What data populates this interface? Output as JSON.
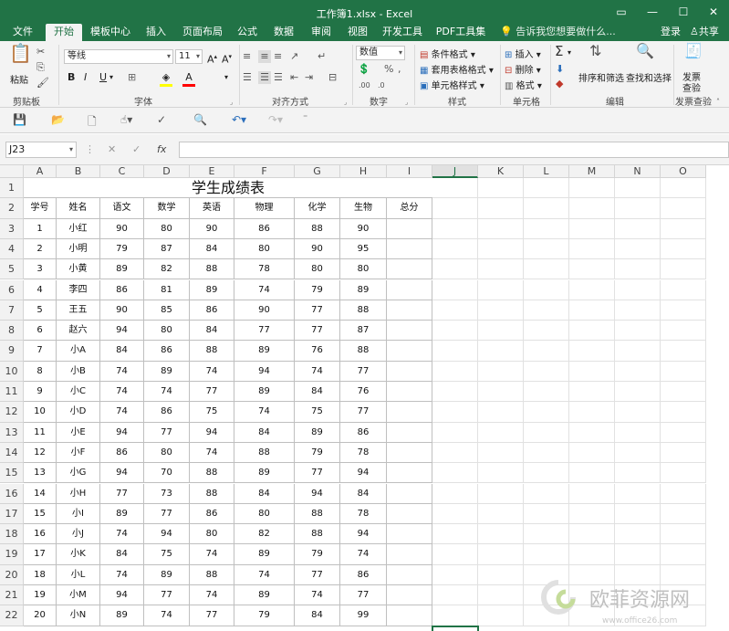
{
  "window": {
    "title": "工作簿1.xlsx - Excel"
  },
  "tabs": [
    "文件",
    "开始",
    "模板中心",
    "插入",
    "页面布局",
    "公式",
    "数据",
    "审阅",
    "视图",
    "开发工具",
    "PDF工具集"
  ],
  "active_tab": "开始",
  "tell_me": "告诉我您想要做什么...",
  "account": {
    "login": "登录",
    "share": "共享"
  },
  "ribbon": {
    "clipboard": {
      "paste": "粘贴",
      "label": "剪贴板"
    },
    "font": {
      "name": "等线",
      "size": "11",
      "bold": "B",
      "italic": "I",
      "underline": "U",
      "label": "字体"
    },
    "alignment": {
      "label": "对齐方式"
    },
    "number": {
      "format": "数值",
      "label": "数字"
    },
    "styles": {
      "conditional": "条件格式",
      "table": "套用表格格式",
      "cell": "单元格样式",
      "label": "样式"
    },
    "cells": {
      "insert": "插入",
      "delete": "删除",
      "format": "格式",
      "label": "单元格"
    },
    "editing": {
      "sort": "排序和筛选",
      "find": "查找和选择",
      "label": "编辑"
    },
    "check": {
      "line1": "发票",
      "line2": "查验",
      "label": "发票查验"
    }
  },
  "formula_bar": {
    "name_box": "J23",
    "fx": "fx",
    "value": ""
  },
  "columns": [
    "A",
    "B",
    "C",
    "D",
    "E",
    "F",
    "G",
    "H",
    "I",
    "J",
    "K",
    "L",
    "M",
    "N",
    "O"
  ],
  "selected_column": "J",
  "sheet": {
    "title": "学生成绩表",
    "headers": [
      "学号",
      "姓名",
      "语文",
      "数学",
      "英语",
      "物理",
      "化学",
      "生物",
      "总分"
    ],
    "rows": [
      [
        "1",
        "小红",
        "90",
        "80",
        "90",
        "86",
        "88",
        "90",
        ""
      ],
      [
        "2",
        "小明",
        "79",
        "87",
        "84",
        "80",
        "90",
        "95",
        ""
      ],
      [
        "3",
        "小黄",
        "89",
        "82",
        "88",
        "78",
        "80",
        "80",
        ""
      ],
      [
        "4",
        "李四",
        "86",
        "81",
        "89",
        "74",
        "79",
        "89",
        ""
      ],
      [
        "5",
        "王五",
        "90",
        "85",
        "86",
        "90",
        "77",
        "88",
        ""
      ],
      [
        "6",
        "赵六",
        "94",
        "80",
        "84",
        "77",
        "77",
        "87",
        ""
      ],
      [
        "7",
        "小A",
        "84",
        "86",
        "88",
        "89",
        "76",
        "88",
        ""
      ],
      [
        "8",
        "小B",
        "74",
        "89",
        "74",
        "94",
        "74",
        "77",
        ""
      ],
      [
        "9",
        "小C",
        "74",
        "74",
        "77",
        "89",
        "84",
        "76",
        ""
      ],
      [
        "10",
        "小D",
        "74",
        "86",
        "75",
        "74",
        "75",
        "77",
        ""
      ],
      [
        "11",
        "小E",
        "94",
        "77",
        "94",
        "84",
        "89",
        "86",
        ""
      ],
      [
        "12",
        "小F",
        "86",
        "80",
        "74",
        "88",
        "79",
        "78",
        ""
      ],
      [
        "13",
        "小G",
        "94",
        "70",
        "88",
        "89",
        "77",
        "94",
        ""
      ],
      [
        "14",
        "小H",
        "77",
        "73",
        "88",
        "84",
        "94",
        "84",
        ""
      ],
      [
        "15",
        "小I",
        "89",
        "77",
        "86",
        "80",
        "88",
        "78",
        ""
      ],
      [
        "16",
        "小J",
        "74",
        "94",
        "80",
        "82",
        "88",
        "94",
        ""
      ],
      [
        "17",
        "小K",
        "84",
        "75",
        "74",
        "89",
        "79",
        "74",
        ""
      ],
      [
        "18",
        "小L",
        "74",
        "89",
        "88",
        "74",
        "77",
        "86",
        ""
      ],
      [
        "19",
        "小M",
        "94",
        "77",
        "74",
        "89",
        "74",
        "77",
        ""
      ],
      [
        "20",
        "小N",
        "89",
        "74",
        "77",
        "79",
        "84",
        "99",
        ""
      ]
    ]
  },
  "watermark": {
    "text": "欧菲资源网",
    "url": "www.office26.com"
  },
  "colors": {
    "accent": "#217346"
  }
}
